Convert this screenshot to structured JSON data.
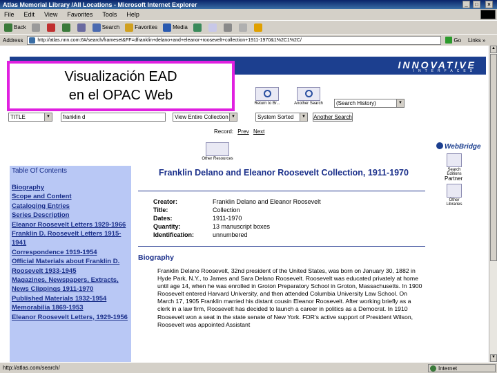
{
  "window": {
    "title": "Atlas Memorial Library /All Locations - Microsoft Internet Explorer",
    "controls": [
      "_",
      "□",
      "×"
    ]
  },
  "menu": [
    "File",
    "Edit",
    "View",
    "Favorites",
    "Tools",
    "Help"
  ],
  "toolbar": {
    "back": "Back",
    "forward": "→",
    "search": "Search",
    "favorites": "Favorites",
    "media": "Media"
  },
  "address": {
    "label": "Address",
    "url": "http://atlas.nnn.com:6#/search/frameset&FF=dfranklin+delano+and+eleanor+roosevelt+collection+1911-1970&1%2C1%2C/",
    "go": "Go",
    "links": "Links »"
  },
  "overlay": {
    "line1": "Visualización EAD",
    "line2": "en el OPAC Web"
  },
  "opac": {
    "brand": "INNOVATIVE",
    "brand_sub": "INTERFACES",
    "buttons": {
      "return": "Return to Br...",
      "another": "Another Search",
      "other_resources": "Other Resources",
      "search_editions": "Search Editions",
      "other_libraries": "Other Libraries"
    },
    "search_history": "(Search History)",
    "index": "TITLE",
    "query": "franklin d",
    "scope": "View Entire Collection",
    "sort": "System Sorted",
    "another_search": "Another Search",
    "record_label": "Record:",
    "prev": "Prev",
    "next": "Next",
    "webbridge": "WebBridge",
    "partner": "Partner"
  },
  "toc": {
    "title": "Table Of Contents",
    "items": [
      "Biography",
      "Scope and Content",
      "Cataloging Entries",
      "Series Description",
      "Eleanor Roosevelt Letters 1929-1966",
      "Franklin D. Roosevelt Letters 1915-1941",
      "Correspondence 1919-1954",
      "Official Materials about Franklin D. Roosevelt 1933-1945",
      "Magazines, Newspapers, Extracts, News Clippings 1911-1970",
      "Published Materials 1932-1954",
      "Memorabilia 1869-1953",
      "Eleanor Roosevelt Letters, 1929-1956"
    ]
  },
  "finding_aid": {
    "title": "Franklin Delano and Eleanor Roosevelt Collection, 1911-1970",
    "fields": [
      {
        "label": "Creator:",
        "value": "Franklin Delano and Eleanor Roosevelt"
      },
      {
        "label": "Title:",
        "value": "Collection"
      },
      {
        "label": "Dates:",
        "value": "1911-1970"
      },
      {
        "label": "Quantity:",
        "value": "13 manuscript boxes"
      },
      {
        "label": "Identification:",
        "value": "unnumbered"
      }
    ],
    "section": "Biography",
    "body": "Franklin Delano Roosevelt, 32nd president of the United States, was born on January 30, 1882 in Hyde Park, N.Y., to James and Sara Delano Roosevelt. Roosevelt was educated privately at home until age 14, when he was enrolled in Groton Preparatory School in Groton, Massachusetts. In 1900 Roosevelt entered Harvard University, and then attended Columbia University Law School. On March 17, 1905 Franklin married his distant cousin Eleanor Roosevelt. After working briefly as a clerk in a law firm, Roosevelt has decided to launch a career in politics as a Democrat. In 1910 Roosevelt won a seat in the state senate of New York. FDR's active support of President Wilson, Roosevelt was appointed Assistant"
  },
  "status": {
    "text": "http://atlas.com/search/",
    "zone": "Internet"
  }
}
